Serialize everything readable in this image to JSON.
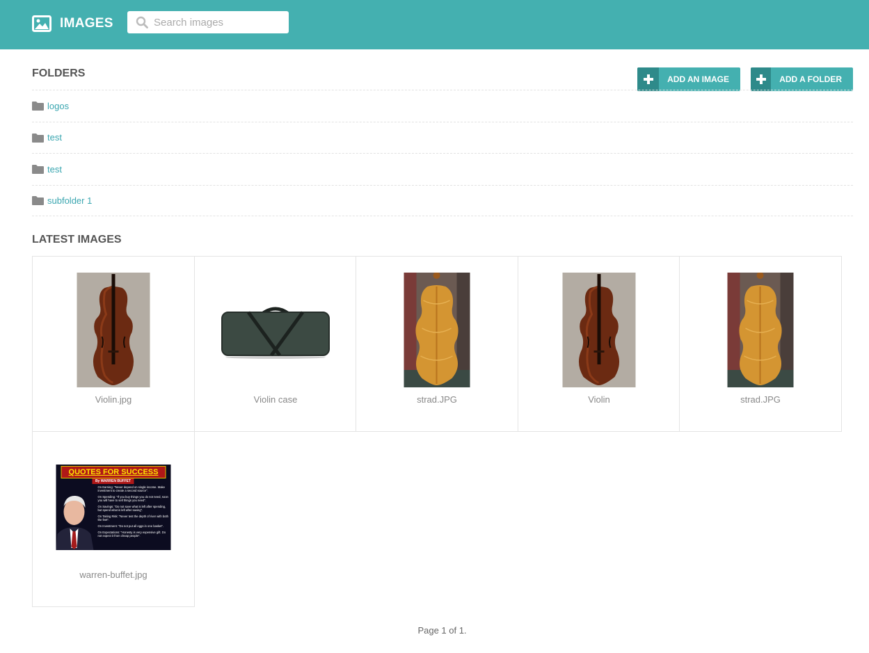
{
  "header": {
    "title": "IMAGES",
    "brand_icon": "image-icon",
    "search": {
      "placeholder": "Search images",
      "value": "",
      "icon": "search-icon"
    },
    "color": "#44b0b0"
  },
  "actions": {
    "add_image": "ADD AN IMAGE",
    "add_folder": "ADD A FOLDER",
    "icon": "plus-icon"
  },
  "folders": {
    "title": "FOLDERS",
    "items": [
      {
        "label": "logos"
      },
      {
        "label": "test"
      },
      {
        "label": "test"
      },
      {
        "label": "subfolder 1"
      }
    ]
  },
  "latest": {
    "title": "LATEST IMAGES",
    "items": [
      {
        "label": "Violin.jpg",
        "thumb": "violin-front"
      },
      {
        "label": "Violin case",
        "thumb": "violin-case"
      },
      {
        "label": "strad.JPG",
        "thumb": "violin-back"
      },
      {
        "label": "Violin",
        "thumb": "violin-front"
      },
      {
        "label": "strad.JPG",
        "thumb": "violin-back"
      },
      {
        "label": "warren-buffet.jpg",
        "thumb": "quote-poster"
      }
    ]
  },
  "poster": {
    "heading": "QUOTES FOR SUCCESS",
    "byline": "By WARREN BUFFET",
    "lines": [
      "On Earning: \"Never depend on single income. Make investment to create a second source\".",
      "On Spending: \"If you buy things you do not need, soon you will have to sell things you need\".",
      "On Savings: \"Do not save what is left after spending, but spend what is left after saving\".",
      "On Taking Risk: \"Never test the depth of river with both the feet\".",
      "On Investment: \"Do not put all eggs in one basket\".",
      "On Expectations: \"Honesty is very expensive gift. Do not expect it from cheap people\"."
    ]
  },
  "pagination": "Page 1 of 1."
}
